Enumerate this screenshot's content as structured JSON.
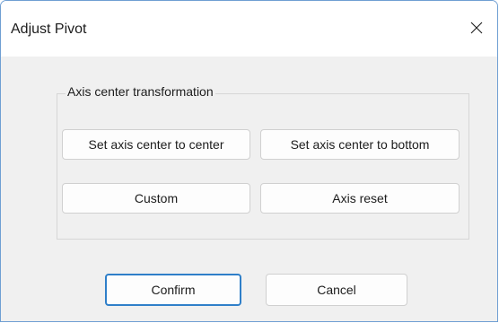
{
  "window": {
    "title": "Adjust Pivot",
    "close_icon": "close-icon"
  },
  "group": {
    "label": "Axis center transformation",
    "buttons": {
      "center": "Set axis center to center",
      "bottom": "Set axis center to bottom",
      "custom": "Custom",
      "reset": "Axis reset"
    }
  },
  "footer": {
    "confirm": "Confirm",
    "cancel": "Cancel"
  },
  "colors": {
    "accent": "#2f7fc9",
    "window_border": "#6f9fd3",
    "client_bg": "#f0f0f0"
  }
}
